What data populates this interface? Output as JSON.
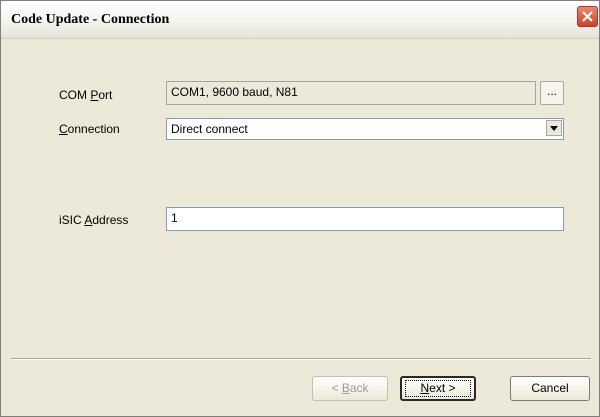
{
  "window": {
    "title": "Code Update - Connection"
  },
  "com_port": {
    "label_prefix": "COM ",
    "label_key": "P",
    "label_suffix": "ort",
    "value": "COM1, 9600 baud, N81",
    "browse_label": "..."
  },
  "connection": {
    "label_key": "C",
    "label_suffix": "onnection",
    "value": "Direct connect"
  },
  "isic_address": {
    "label_prefix": "iSIC ",
    "label_key": "A",
    "label_suffix": "ddress",
    "value": "1"
  },
  "buttons": {
    "back": {
      "prefix": "< ",
      "key": "B",
      "suffix": "ack"
    },
    "next": {
      "key": "N",
      "suffix": "ext >"
    },
    "cancel": {
      "label": "Cancel"
    }
  }
}
